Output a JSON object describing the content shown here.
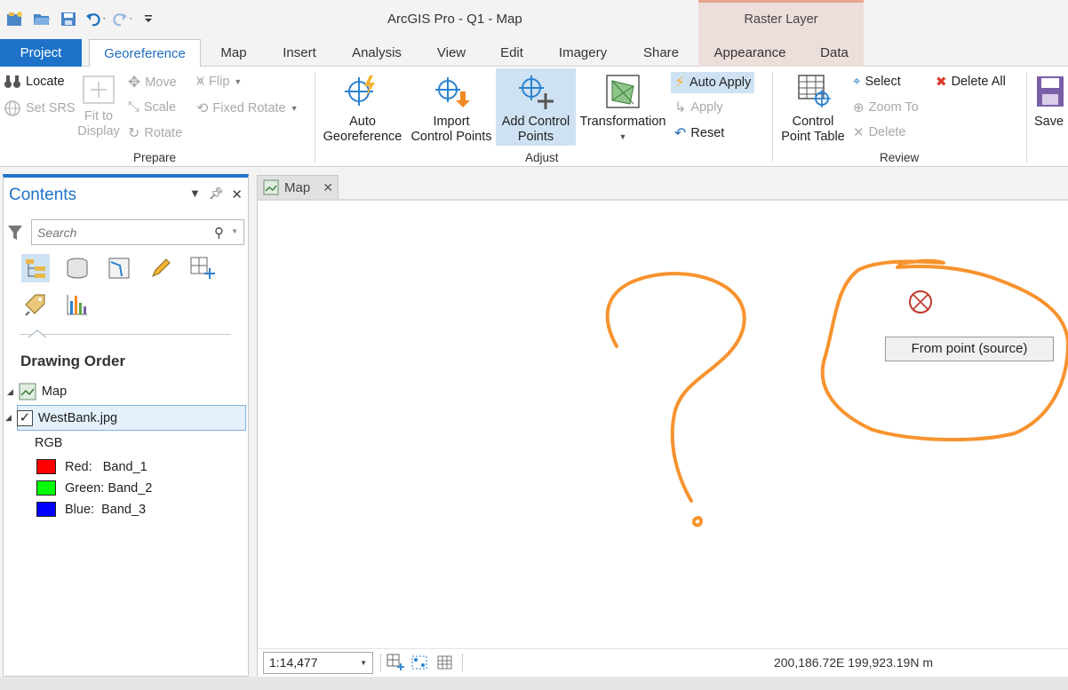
{
  "titlebar": {
    "app_title": "ArcGIS Pro - Q1 - Map",
    "context_group": "Raster Layer",
    "qat": [
      "new-project-icon",
      "open-project-icon",
      "save-project-icon",
      "undo-icon",
      "redo-icon",
      "customize-icon"
    ]
  },
  "tabs": {
    "project": "Project",
    "georeference": "Georeference",
    "map": "Map",
    "insert": "Insert",
    "analysis": "Analysis",
    "view": "View",
    "edit": "Edit",
    "imagery": "Imagery",
    "share": "Share",
    "appearance": "Appearance",
    "data": "Data"
  },
  "ribbon": {
    "prepare": {
      "group_label": "Prepare",
      "locate": "Locate",
      "set_srs": "Set SRS",
      "fit_line1": "Fit to",
      "fit_line2": "Display",
      "move": "Move",
      "scale": "Scale",
      "rotate": "Rotate",
      "flip": "Flip",
      "fixed_rotate": "Fixed Rotate"
    },
    "adjust": {
      "group_label": "Adjust",
      "auto_geo_line1": "Auto",
      "auto_geo_line2": "Georeference",
      "import_line1": "Import",
      "import_line2": "Control Points",
      "add_line1": "Add Control",
      "add_line2": "Points",
      "transformation": "Transformation",
      "auto_apply": "Auto Apply",
      "apply": "Apply",
      "reset": "Reset"
    },
    "review": {
      "group_label": "Review",
      "table_line1": "Control",
      "table_line2": "Point Table",
      "select": "Select",
      "zoom_to": "Zoom To",
      "delete": "Delete",
      "delete_all": "Delete All"
    },
    "save": "Save"
  },
  "contents": {
    "title": "Contents",
    "search_placeholder": "Search",
    "drawing_order": "Drawing Order",
    "map_item": "Map",
    "layer_name": "WestBank.jpg",
    "rgb_label": "RGB",
    "bands": [
      {
        "label": "Red:   Band_1",
        "color": "#ff0000"
      },
      {
        "label": "Green: Band_2",
        "color": "#00ff00"
      },
      {
        "label": "Blue:  Band_3",
        "color": "#0000ff"
      }
    ]
  },
  "map_tab": {
    "label": "Map"
  },
  "map_view": {
    "tooltip": "From point (source)",
    "stroke_color": "#f7932e"
  },
  "statusbar": {
    "scale": "1:14,477",
    "coordinates": "200,186.72E 199,923.19N m"
  }
}
